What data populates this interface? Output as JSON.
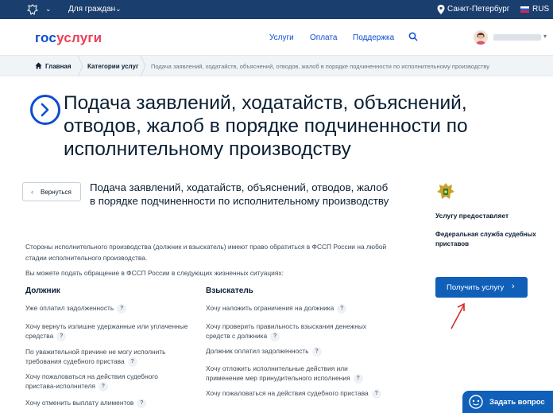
{
  "topbar": {
    "chevron": "⌄",
    "for_citizens": "Для граждан",
    "city": "Санкт-Петербург",
    "lang": "RUS"
  },
  "header": {
    "logo_part1": "гос",
    "logo_part2": "услуги",
    "nav": [
      "Услуги",
      "Оплата",
      "Поддержка"
    ],
    "user_chevron": "▾"
  },
  "breadcrumb": {
    "home": "Главная",
    "category": "Категории услуг",
    "current": "Подача заявлений, ходатайств, объяснений, отводов, жалоб в порядке подчиненности по исполнительному производству"
  },
  "page": {
    "title": "Подача заявлений, ходатайств, объяснений, отводов, жалоб в порядке подчиненности по исполнительному производству",
    "back_label": "Вернуться",
    "back_arrow": "‹",
    "subtitle": "Подача заявлений, ходатайств, объяснений, отводов, жалоб в порядке подчиненности по исполнительному производству",
    "lead1": "Стороны исполнительного производства (должник и взыскатель) имеют право обратиться в ФССП России на любой стадии исполнительного производства.",
    "lead2": "Вы можете подать обращение в ФССП России в следующих жизненных ситуациях:",
    "qmark": "?",
    "debtor": {
      "heading": "Должник",
      "items": [
        "Уже оплатил задолженность",
        "Хочу вернуть излишне удержанные или уплаченные средства",
        "По уважительной причине не могу исполнить требования судебного пристава",
        "Хочу пожаловаться на действия судебного пристава-исполнителя",
        "Хочу отменить выплату алиментов"
      ]
    },
    "creditor": {
      "heading": "Взыскатель",
      "items": [
        "Хочу наложить ограничения на должника",
        "Хочу проверить правильность взыскания денежных средств с должника",
        "Должник оплатил задолженность",
        "Хочу отложить исполнительные действия или применение мер принудительного исполнения",
        "Хочу пожаловаться на действия судебного пристава"
      ]
    }
  },
  "aside": {
    "provider_label": "Услугу предоставляет",
    "provider_name": "Федеральная служба судебных приставов",
    "get_button": "Получить услугу",
    "get_arrow": "›"
  },
  "ask": {
    "label": "Задать вопрос"
  },
  "colors": {
    "brand_blue": "#0d4cd3",
    "brand_red": "#ee3f58",
    "button_blue": "#1060b9",
    "topbar": "#1a3e6e"
  }
}
